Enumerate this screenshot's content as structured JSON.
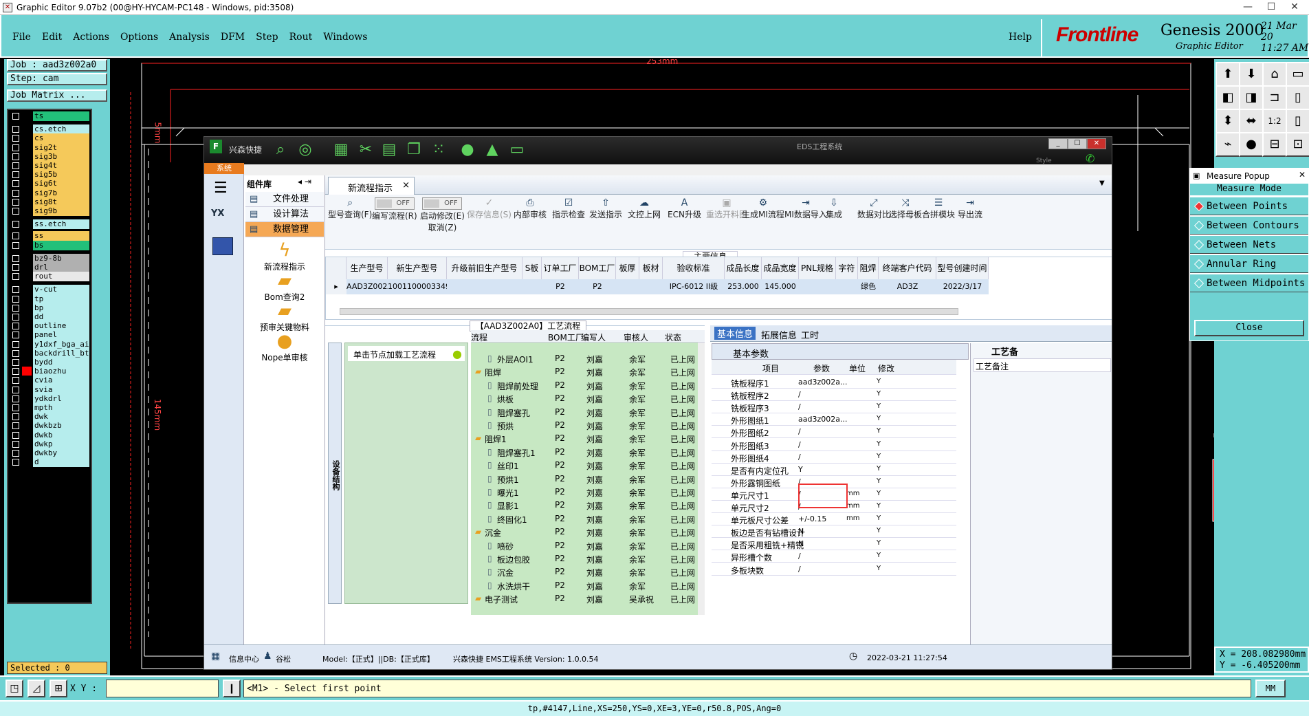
{
  "window_title": "Graphic Editor 9.07b2 (00@HY-HYCAM-PC148 - Windows, pid:3508)",
  "menu": [
    "File",
    "Edit",
    "Actions",
    "Options",
    "Analysis",
    "DFM",
    "Step",
    "Rout",
    "Windows"
  ],
  "help": "Help",
  "brand": {
    "logo": "Frontline",
    "product": "Genesis 2000",
    "subtitle": "Graphic Editor",
    "date": "21 Mar 20",
    "time": "11:27 AM"
  },
  "job": {
    "job": "Job : aad3z002a0",
    "step": "Step: cam",
    "matrix": "Job Matrix ..."
  },
  "layers": [
    {
      "name": "ts",
      "color": "#22c07a"
    },
    {
      "name": "cs.etch",
      "color": "#b6eded"
    },
    {
      "name": "cs",
      "color": "#f5c95a"
    },
    {
      "name": "sig2t",
      "color": "#f5c95a"
    },
    {
      "name": "sig3b",
      "color": "#f5c95a"
    },
    {
      "name": "sig4t",
      "color": "#f5c95a"
    },
    {
      "name": "sig5b",
      "color": "#f5c95a"
    },
    {
      "name": "sig6t",
      "color": "#f5c95a"
    },
    {
      "name": "sig7b",
      "color": "#f5c95a"
    },
    {
      "name": "sig8t",
      "color": "#f5c95a"
    },
    {
      "name": "sig9b",
      "color": "#f5c95a"
    },
    {
      "name": "ss.etch",
      "color": "#b6eded"
    },
    {
      "name": "ss",
      "color": "#f5c95a"
    },
    {
      "name": "bs",
      "color": "#22c07a"
    },
    {
      "name": "bz9-8b",
      "color": "#b0b0b0"
    },
    {
      "name": "drl",
      "color": "#b0b0b0"
    },
    {
      "name": "rout",
      "color": "#e8e8e8"
    },
    {
      "name": "v-cut",
      "color": "#b6eded"
    },
    {
      "name": "tp",
      "color": "#b6eded"
    },
    {
      "name": "bp",
      "color": "#b6eded"
    },
    {
      "name": "dd",
      "color": "#b6eded"
    },
    {
      "name": "outline",
      "color": "#b6eded"
    },
    {
      "name": "panel",
      "color": "#b6eded"
    },
    {
      "name": "y1dxf_bga_ai",
      "color": "#b6eded"
    },
    {
      "name": "backdrill_bt",
      "color": "#b6eded"
    },
    {
      "name": "bydd",
      "color": "#b6eded"
    },
    {
      "name": "biaozhu",
      "color": "#b6eded"
    },
    {
      "name": "cvia",
      "color": "#b6eded"
    },
    {
      "name": "svia",
      "color": "#b6eded"
    },
    {
      "name": "ydkdrl",
      "color": "#b6eded"
    },
    {
      "name": "mpth",
      "color": "#b6eded"
    },
    {
      "name": "dwk",
      "color": "#b6eded"
    },
    {
      "name": "dwkbzb",
      "color": "#b6eded"
    },
    {
      "name": "dwkb",
      "color": "#b6eded"
    },
    {
      "name": "dwkp",
      "color": "#b6eded"
    },
    {
      "name": "dwkby",
      "color": "#b6eded"
    },
    {
      "name": "d",
      "color": "#b6eded"
    }
  ],
  "selected": "Selected : 0",
  "dims": {
    "width": "253mm",
    "height": "145mm",
    "margin": "5mm"
  },
  "measure": {
    "title": "Measure Popup",
    "mode": "Measure Mode",
    "options": [
      "Between Points",
      "Between Contours",
      "Between Nets",
      "Annular Ring",
      "Between Midpoints"
    ],
    "close": "Close"
  },
  "coords": {
    "x": "X = 208.082980mm",
    "y": "Y = -6.405200mm"
  },
  "bottom": {
    "xy": "X Y :",
    "prompt": "<M1> - Select first point",
    "unit": "MM",
    "status": "tp,#4147,Line,XS=250,YS=0,XE=3,YE=0,r50.8,POS,Ang=0"
  },
  "eds": {
    "brand": "兴森快捷",
    "title": "EDS工程系统",
    "system": "系统",
    "style": "Style",
    "comp_title": "组件库",
    "comp_menu": [
      "文件处理",
      "设计算法",
      "数据管理"
    ],
    "comp_items": [
      "新流程指示",
      "Bom查询2",
      "预审关键物料",
      "Nope单审核"
    ],
    "tab": "新流程指示",
    "ribbon": [
      "型号查询(F)",
      "编写流程(R)",
      "启动修改(E)",
      "保存信息(S)",
      "内部审核",
      "指示检查",
      "发送指示",
      "文控上网",
      "ECN升级",
      "重选开料图",
      "生成MI流程",
      "MI数据导入",
      "集成",
      "数据对比",
      "选择母板",
      "合拼模块",
      "导出流"
    ],
    "toggle_off": "OFF",
    "cancel": "取消(Z)",
    "main_info": "主要信息",
    "grid_headers": [
      "生产型号",
      "新生产型号",
      "升级前旧生产型号",
      "S板",
      "订单工厂",
      "BOM工厂",
      "板厚",
      "板材",
      "验收标准",
      "成品长度",
      "成品宽度",
      "PNL规格",
      "字符",
      "阻焊",
      "终端客户代码",
      "型号创建时间"
    ],
    "grid_row": [
      "AAD3Z002A0",
      "10011000033498",
      "",
      "",
      "P2",
      "P2",
      "",
      "",
      "IPC-6012 II级",
      "253.000",
      "145.000",
      "",
      "",
      "绿色",
      "AD3Z",
      "2022/3/17"
    ],
    "proc_title": "【AAD3Z002A0】工艺流程",
    "device_struct": "设备结构",
    "click_load": "单击节点加载工艺流程",
    "tree_headers": [
      "流程",
      "BOM工厂",
      "编写人",
      "审核人",
      "状态"
    ],
    "tree_rows": [
      {
        "n": "外层AOI1",
        "l": 2,
        "f": "P2",
        "w": "刘嘉",
        "a": "余军",
        "s": "已上网"
      },
      {
        "n": "阻焊",
        "l": 1,
        "f": "P2",
        "w": "刘嘉",
        "a": "余军",
        "s": "已上网"
      },
      {
        "n": "阻焊前处理",
        "l": 2,
        "f": "P2",
        "w": "刘嘉",
        "a": "余军",
        "s": "已上网"
      },
      {
        "n": "烘板",
        "l": 2,
        "f": "P2",
        "w": "刘嘉",
        "a": "余军",
        "s": "已上网"
      },
      {
        "n": "阻焊塞孔",
        "l": 2,
        "f": "P2",
        "w": "刘嘉",
        "a": "余军",
        "s": "已上网"
      },
      {
        "n": "预烘",
        "l": 2,
        "f": "P2",
        "w": "刘嘉",
        "a": "余军",
        "s": "已上网"
      },
      {
        "n": "阻焊1",
        "l": 1,
        "f": "P2",
        "w": "刘嘉",
        "a": "余军",
        "s": "已上网"
      },
      {
        "n": "阻焊塞孔1",
        "l": 2,
        "f": "P2",
        "w": "刘嘉",
        "a": "余军",
        "s": "已上网"
      },
      {
        "n": "丝印1",
        "l": 2,
        "f": "P2",
        "w": "刘嘉",
        "a": "余军",
        "s": "已上网"
      },
      {
        "n": "预烘1",
        "l": 2,
        "f": "P2",
        "w": "刘嘉",
        "a": "余军",
        "s": "已上网"
      },
      {
        "n": "曝光1",
        "l": 2,
        "f": "P2",
        "w": "刘嘉",
        "a": "余军",
        "s": "已上网"
      },
      {
        "n": "显影1",
        "l": 2,
        "f": "P2",
        "w": "刘嘉",
        "a": "余军",
        "s": "已上网"
      },
      {
        "n": "终固化1",
        "l": 2,
        "f": "P2",
        "w": "刘嘉",
        "a": "余军",
        "s": "已上网"
      },
      {
        "n": "沉金",
        "l": 1,
        "f": "P2",
        "w": "刘嘉",
        "a": "余军",
        "s": "已上网"
      },
      {
        "n": "喷砂",
        "l": 2,
        "f": "P2",
        "w": "刘嘉",
        "a": "余军",
        "s": "已上网"
      },
      {
        "n": "板边包胶",
        "l": 2,
        "f": "P2",
        "w": "刘嘉",
        "a": "余军",
        "s": "已上网"
      },
      {
        "n": "沉金",
        "l": 2,
        "f": "P2",
        "w": "刘嘉",
        "a": "余军",
        "s": "已上网"
      },
      {
        "n": "水洗烘干",
        "l": 2,
        "f": "P2",
        "w": "刘嘉",
        "a": "余军",
        "s": "已上网"
      },
      {
        "n": "电子测试",
        "l": 1,
        "f": "P2",
        "w": "刘嘉",
        "a": "吴承祝",
        "s": "已上网"
      }
    ],
    "info_tabs": [
      "基本信息",
      "拓展信息",
      "工时"
    ],
    "basic_params": "基本参数",
    "craft_info": "工艺备",
    "craft_note": "工艺备注",
    "param_headers": [
      "项目",
      "参数",
      "单位",
      "修改"
    ],
    "params": [
      {
        "k": "铣板程序1",
        "v": "aad3z002a...",
        "u": "",
        "m": "Y"
      },
      {
        "k": "铣板程序2",
        "v": "/",
        "u": "",
        "m": "Y"
      },
      {
        "k": "铣板程序3",
        "v": "/",
        "u": "",
        "m": "Y"
      },
      {
        "k": "外形图纸1",
        "v": "aad3z002a...",
        "u": "",
        "m": "Y"
      },
      {
        "k": "外形图纸2",
        "v": "/",
        "u": "",
        "m": "Y"
      },
      {
        "k": "外形图纸3",
        "v": "/",
        "u": "",
        "m": "Y"
      },
      {
        "k": "外形图纸4",
        "v": "/",
        "u": "",
        "m": "Y"
      },
      {
        "k": "是否有内定位孔",
        "v": "Y",
        "u": "",
        "m": "Y"
      },
      {
        "k": "外形露铜图纸",
        "v": "/",
        "u": "",
        "m": "Y"
      },
      {
        "k": "单元尺寸1",
        "v": "/",
        "u": "mm",
        "m": "Y"
      },
      {
        "k": "单元尺寸2",
        "v": "/",
        "u": "mm",
        "m": "Y"
      },
      {
        "k": "单元板尺寸公差",
        "v": "+/-0.15",
        "u": "mm",
        "m": "Y"
      },
      {
        "k": "板边是否有钻槽设计",
        "v": "N",
        "u": "",
        "m": "Y"
      },
      {
        "k": "是否采用粗铣+精铣",
        "v": "N",
        "u": "",
        "m": "Y"
      },
      {
        "k": "异形槽个数",
        "v": "/",
        "u": "",
        "m": "Y"
      },
      {
        "k": "多板块数",
        "v": "/",
        "u": "",
        "m": "Y"
      }
    ],
    "status_bar": {
      "info": "信息中心",
      "gu": "谷松",
      "model": "Model:【正式】||DB:【正式库】",
      "sys": "兴森快捷  EMS工程系统  Version: 1.0.0.54",
      "time": "2022-03-21 11:27:54"
    }
  }
}
